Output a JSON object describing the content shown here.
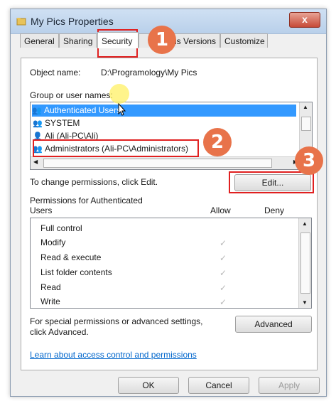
{
  "window": {
    "title": "My Pics Properties",
    "close_label": "x"
  },
  "tabs": [
    {
      "label": "General"
    },
    {
      "label": "Sharing"
    },
    {
      "label": "Security"
    },
    {
      "label": "Previous Versions"
    },
    {
      "label": "Customize"
    }
  ],
  "object": {
    "label": "Object name:",
    "value": "D:\\Programology\\My Pics"
  },
  "groups": {
    "label": "Group or user names:",
    "items": [
      {
        "label": "Authenticated Users"
      },
      {
        "label": "SYSTEM"
      },
      {
        "label": "Ali (Ali-PC\\Ali)"
      },
      {
        "label": "Administrators (Ali-PC\\Administrators)"
      }
    ]
  },
  "change_text": "To change permissions, click Edit.",
  "edit_label": "Edit...",
  "permissions": {
    "title_line1": "Permissions for Authenticated",
    "title_line2": "Users",
    "allow_header": "Allow",
    "deny_header": "Deny",
    "items": [
      {
        "label": "Full control",
        "allow": false
      },
      {
        "label": "Modify",
        "allow": true
      },
      {
        "label": "Read & execute",
        "allow": true
      },
      {
        "label": "List folder contents",
        "allow": true
      },
      {
        "label": "Read",
        "allow": true
      },
      {
        "label": "Write",
        "allow": true
      }
    ],
    "check_glyph": "✓"
  },
  "special": {
    "line1": "For special permissions or advanced settings,",
    "line2": "click Advanced.",
    "advanced_label": "Advanced"
  },
  "learn_link": "Learn about access control and permissions",
  "footer": {
    "ok_label": "OK",
    "cancel_label": "Cancel",
    "apply_label": "Apply"
  },
  "annotations": {
    "step1": "1",
    "step2": "2",
    "step3": "3",
    "color": "#e8734a",
    "box_color": "#e02020"
  }
}
